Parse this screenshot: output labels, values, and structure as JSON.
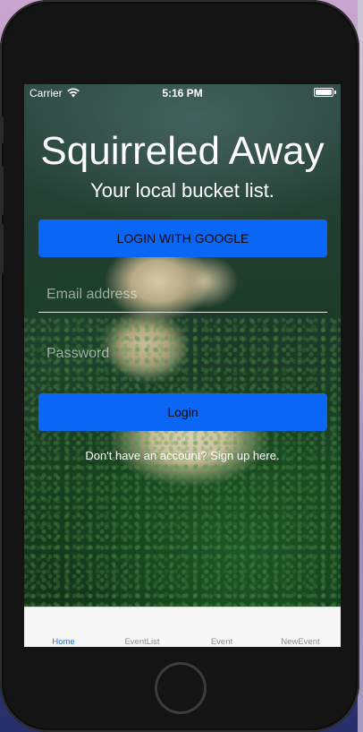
{
  "status_bar": {
    "carrier": "Carrier",
    "time": "5:16 PM",
    "wifi_icon": "wifi-icon",
    "battery_icon": "battery-icon"
  },
  "app": {
    "title": "Squirreled Away",
    "subtitle": "Your local bucket list."
  },
  "login": {
    "google_button_label": "LOGIN WITH GOOGLE",
    "email_placeholder": "Email address",
    "password_placeholder": "Password",
    "login_button_label": "Login",
    "signup_text": "Don't have an account? Sign up here.",
    "button_color": "#0a66f5"
  },
  "tab_bar": {
    "items": [
      {
        "label": "Home",
        "active": true
      },
      {
        "label": "EventList",
        "active": false
      },
      {
        "label": "Event",
        "active": false
      },
      {
        "label": "NewEvent",
        "active": false
      }
    ],
    "active_color": "#2f6fe0"
  },
  "device": {
    "home_button_icon": "home-button"
  }
}
